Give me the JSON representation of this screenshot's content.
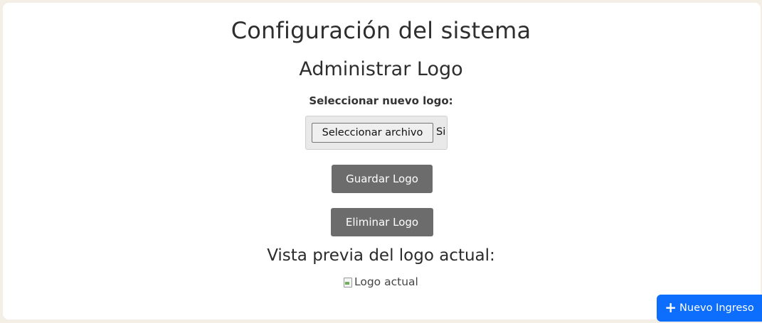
{
  "page": {
    "title": "Configuración del sistema"
  },
  "logo_section": {
    "title": "Administrar Logo",
    "upload_label": "Seleccionar nuevo logo:",
    "file_button_label": "Seleccionar archivo",
    "file_status": "Si",
    "save_button_label": "Guardar Logo",
    "delete_button_label": "Eliminar Logo",
    "preview_title": "Vista previa del logo actual:",
    "logo_alt": "Logo actual"
  },
  "floating_action": {
    "icon": "plus-icon",
    "label": "Nuevo Ingreso"
  },
  "colors": {
    "background": "#f3efe6",
    "card": "#ffffff",
    "grey_button": "#6c6c6c",
    "primary": "#0d6efd"
  }
}
